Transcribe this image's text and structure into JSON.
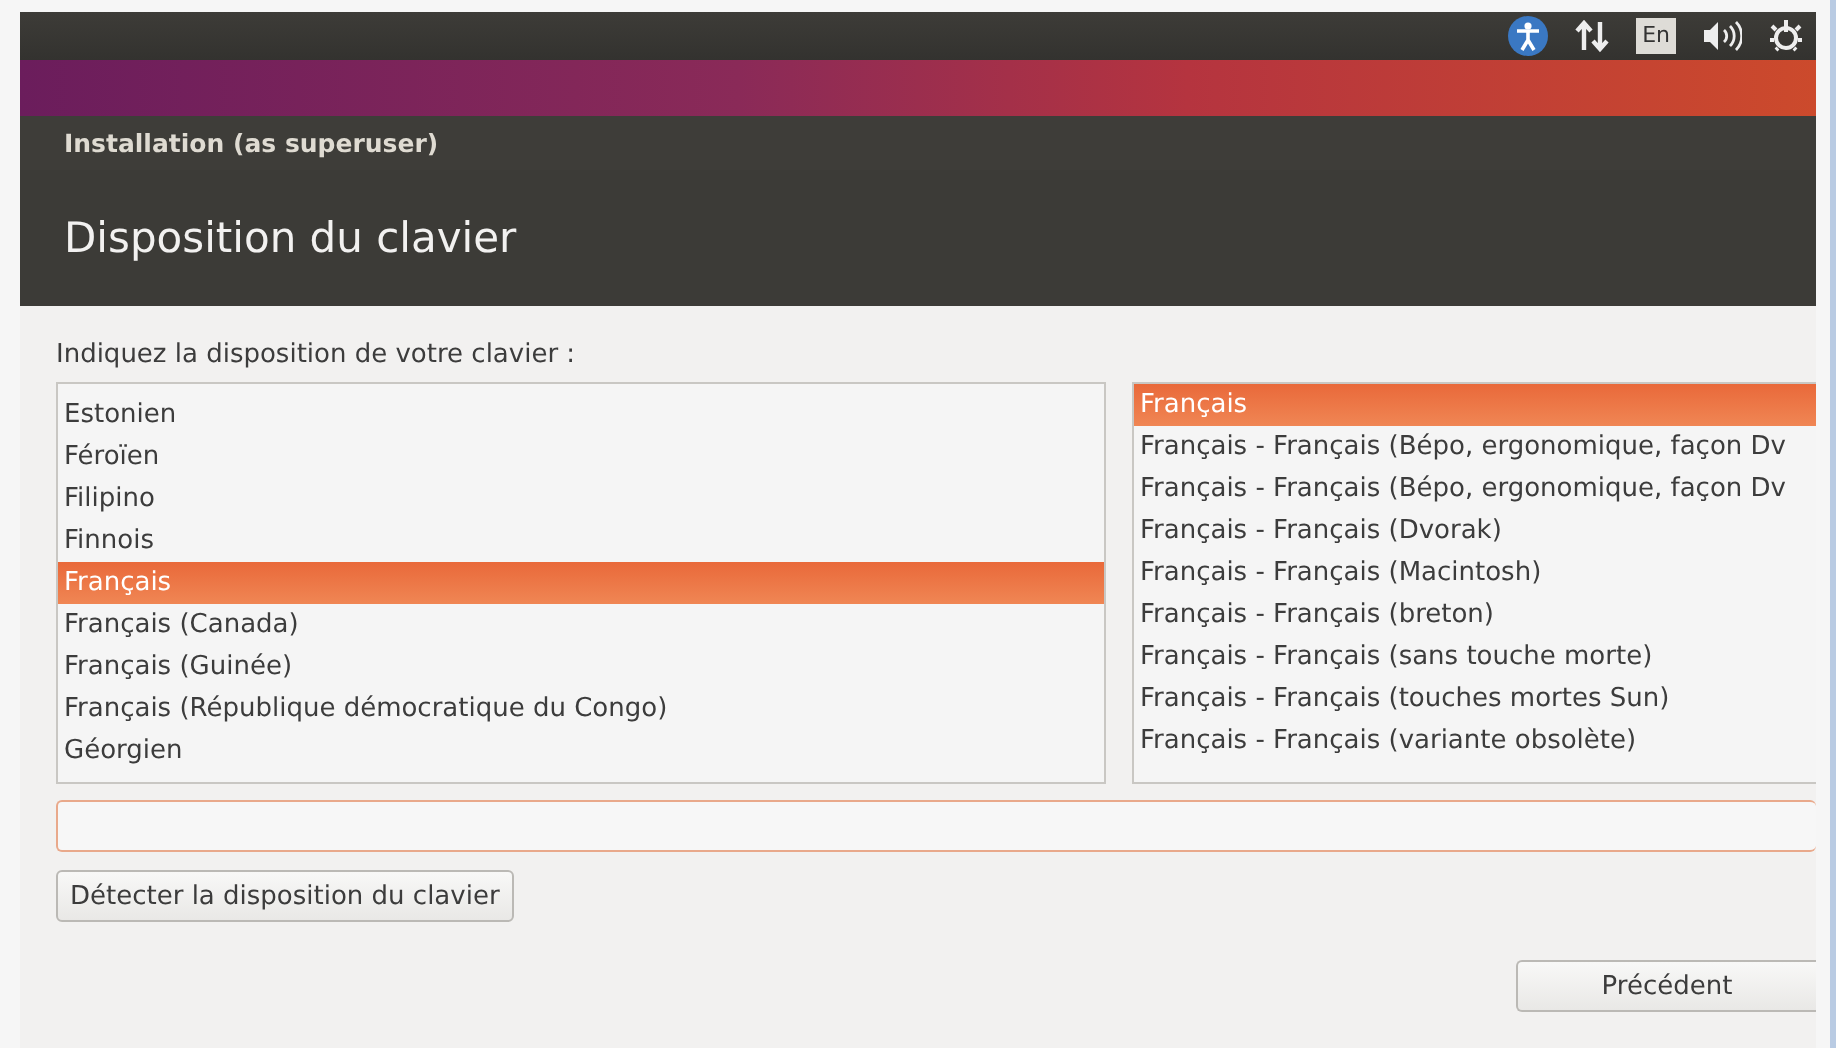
{
  "top_panel": {
    "keyboard_layout": "En"
  },
  "window": {
    "title": "Installation (as superuser)",
    "heading": "Disposition du clavier"
  },
  "prompt": "Indiquez la disposition de votre clavier :",
  "layouts": [
    {
      "label": "Estonien",
      "selected": false
    },
    {
      "label": "Féroïen",
      "selected": false
    },
    {
      "label": "Filipino",
      "selected": false
    },
    {
      "label": "Finnois",
      "selected": false
    },
    {
      "label": "Français",
      "selected": true
    },
    {
      "label": "Français (Canada)",
      "selected": false
    },
    {
      "label": "Français (Guinée)",
      "selected": false
    },
    {
      "label": "Français (République démocratique du Congo)",
      "selected": false
    },
    {
      "label": "Géorgien",
      "selected": false
    }
  ],
  "variants": [
    {
      "label": "Français",
      "selected": true
    },
    {
      "label": "Français - Français (Bépo, ergonomique, façon Dv",
      "selected": false
    },
    {
      "label": "Français - Français (Bépo, ergonomique, façon Dv",
      "selected": false
    },
    {
      "label": "Français - Français (Dvorak)",
      "selected": false
    },
    {
      "label": "Français - Français (Macintosh)",
      "selected": false
    },
    {
      "label": "Français - Français (breton)",
      "selected": false
    },
    {
      "label": "Français - Français (sans touche morte)",
      "selected": false
    },
    {
      "label": "Français - Français (touches mortes Sun)",
      "selected": false
    },
    {
      "label": "Français - Français (variante obsolète)",
      "selected": false
    }
  ],
  "buttons": {
    "detect": "Détecter la disposition du clavier",
    "back": "Précédent"
  }
}
